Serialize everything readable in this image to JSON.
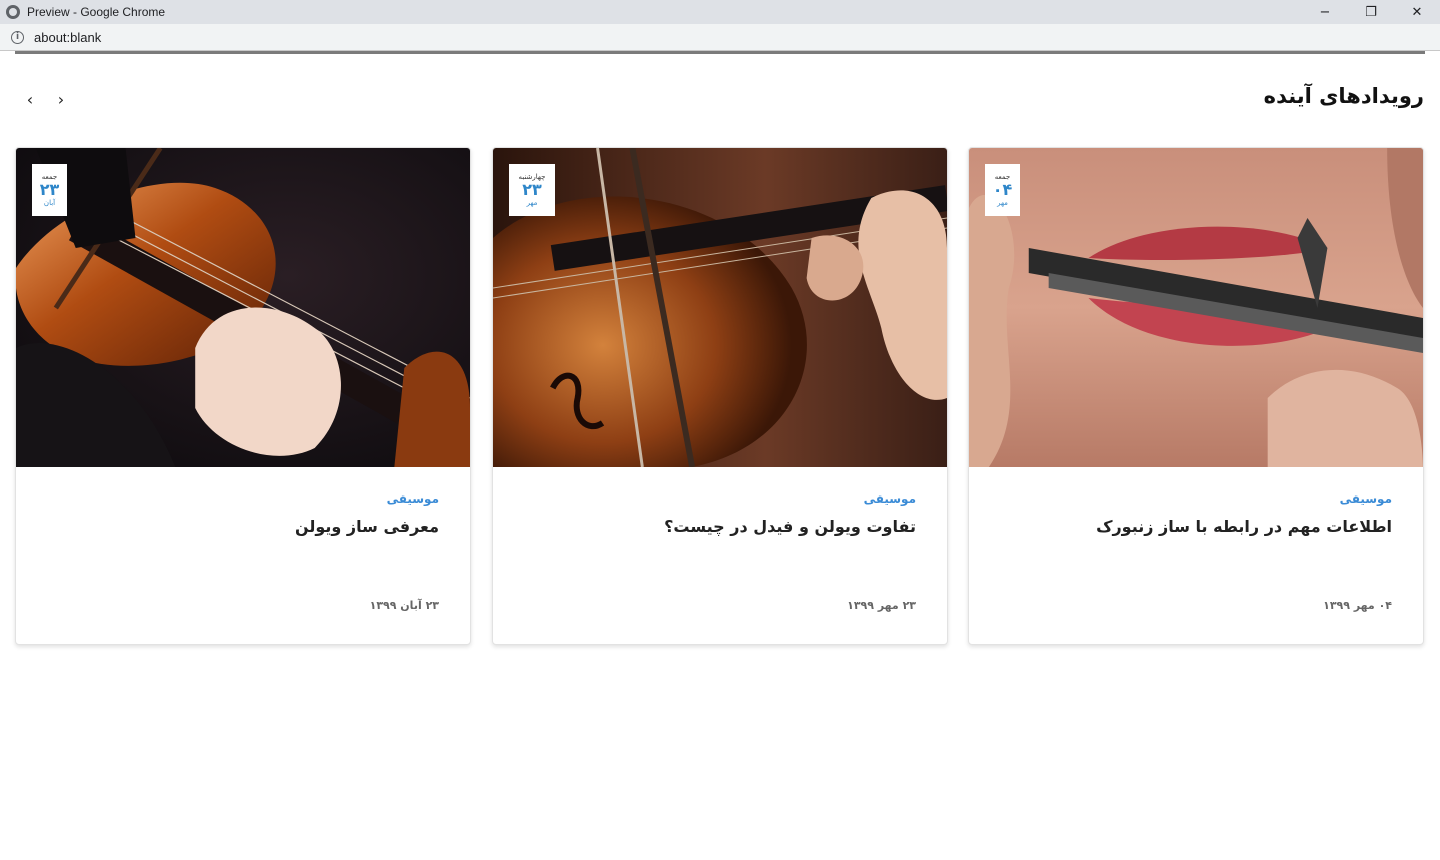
{
  "window": {
    "title": "Preview - Google Chrome",
    "url": "about:blank",
    "minimize_glyph": "−",
    "restore_glyph": "❐",
    "close_glyph": "✕"
  },
  "section": {
    "title": "رویدادهای آینده",
    "prev_arrow": "‹",
    "next_arrow": "›"
  },
  "cards": [
    {
      "badge_day": "جمعه",
      "badge_num": "۲۳",
      "badge_month": "آبان",
      "category": "موسیقی",
      "title": "معرفی ساز ویولن",
      "date": "۲۳ آبان ۱۳۹۹",
      "image_desc_icon": "violin-photo"
    },
    {
      "badge_day": "چهارشنبه",
      "badge_num": "۲۳",
      "badge_month": "مهر",
      "category": "موسیقی",
      "title": "تفاوت ویولن و فیدل در چیست؟",
      "date": "۲۳ مهر ۱۳۹۹",
      "image_desc_icon": "violin-closeup-photo"
    },
    {
      "badge_day": "جمعه",
      "badge_num": "۰۴",
      "badge_month": "مهر",
      "category": "موسیقی",
      "title": "اطلاعات مهم در رابطه با ساز زنبورک",
      "date": "۰۴ مهر ۱۳۹۹",
      "image_desc_icon": "jaw-harp-photo"
    }
  ],
  "colors": {
    "accent": "#2e86c9",
    "category": "#3a8bd6",
    "text": "#222222"
  }
}
